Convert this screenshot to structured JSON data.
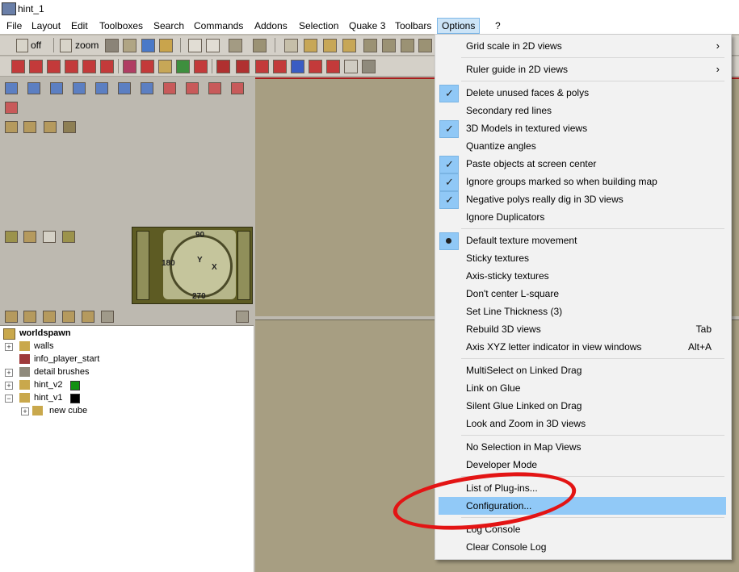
{
  "window": {
    "title": "hint_1"
  },
  "menubar": {
    "items": [
      "File",
      "Layout",
      "Edit",
      "Toolboxes",
      "Search",
      "Commands",
      "Addons",
      "Selection",
      "Quake 3",
      "Toolbars",
      "Options",
      "?"
    ],
    "active": "Options"
  },
  "toolbar": {
    "off_label": "off",
    "zoom_label": "zoom"
  },
  "compass": {
    "north": "90",
    "south": "270",
    "west": "180",
    "x_label": "X",
    "y_label": "Y"
  },
  "tree": {
    "root": "worldspawn",
    "items": [
      {
        "label": "walls",
        "color": null
      },
      {
        "label": "info_player_start",
        "color": null
      },
      {
        "label": "detail brushes",
        "color": null
      },
      {
        "label": "hint_v2",
        "color": "#119111"
      },
      {
        "label": "hint_v1",
        "color": "#000000"
      },
      {
        "label": "new cube",
        "color": null
      }
    ]
  },
  "options_menu": {
    "items": [
      {
        "label": "Grid scale in 2D views",
        "submenu": true
      },
      {
        "label": "Ruler guide in 2D views",
        "submenu": true
      },
      {
        "label": "Delete unused faces & polys",
        "checked": true
      },
      {
        "label": "Secondary red lines",
        "checked": false
      },
      {
        "label": "3D Models in textured views",
        "checked": true
      },
      {
        "label": "Quantize angles",
        "checked": false
      },
      {
        "label": "Paste objects at screen center",
        "checked": true
      },
      {
        "label": "Ignore groups marked so when building map",
        "checked": true
      },
      {
        "label": "Negative polys really dig in 3D views",
        "checked": true
      },
      {
        "label": "Ignore Duplicators",
        "checked": false
      },
      {
        "label": "Default texture movement",
        "radio": true
      },
      {
        "label": "Sticky textures"
      },
      {
        "label": "Axis-sticky textures"
      },
      {
        "label": "Don't center L-square"
      },
      {
        "label": "Set Line Thickness (3)"
      },
      {
        "label": "Rebuild 3D views",
        "shortcut": "Tab"
      },
      {
        "label": "Axis XYZ letter indicator in view windows",
        "shortcut": "Alt+A"
      },
      {
        "label": "MultiSelect on Linked Drag"
      },
      {
        "label": "Link on Glue"
      },
      {
        "label": "Silent Glue Linked on Drag"
      },
      {
        "label": "Look and Zoom in 3D views"
      },
      {
        "label": "No Selection in Map Views"
      },
      {
        "label": "Developer Mode"
      },
      {
        "label": "List of Plug-ins..."
      },
      {
        "label": "Configuration...",
        "highlighted": true
      },
      {
        "label": "Log Console"
      },
      {
        "label": "Clear Console Log"
      }
    ]
  },
  "colors": {
    "highlight": "#91c9f7",
    "annotation": "#e31414",
    "view_bg": "#a79e82",
    "panel_bg": "#bdb9b0"
  }
}
